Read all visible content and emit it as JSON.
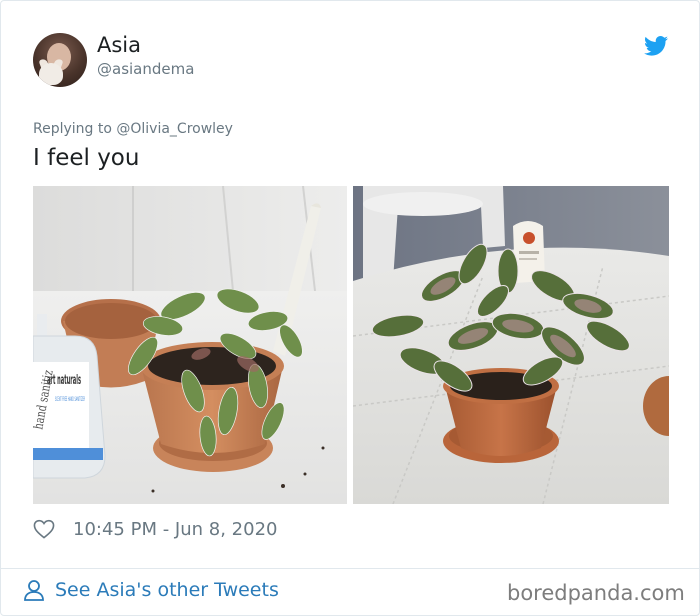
{
  "tweet": {
    "author_name": "Asia",
    "author_handle": "@asiandema",
    "replying_to": "Replying to @Olivia_Crowley",
    "text": "I feel you",
    "timestamp": "10:45 PM - Jun 8, 2020"
  },
  "footer": {
    "see_more": "See Asia's other Tweets",
    "watermark": "boredpanda.com"
  },
  "photos": {
    "left_bottle_label": {
      "brand": "art naturals",
      "text": "SCENT FREE HAND SANITIZER",
      "side_text": "hand sanitiz"
    }
  },
  "colors": {
    "twitter_blue": "#1da1f2",
    "link_blue": "#2b7bb9",
    "muted_gray": "#697882"
  },
  "icons": [
    "twitter-bird-icon",
    "heart-icon",
    "person-icon"
  ]
}
